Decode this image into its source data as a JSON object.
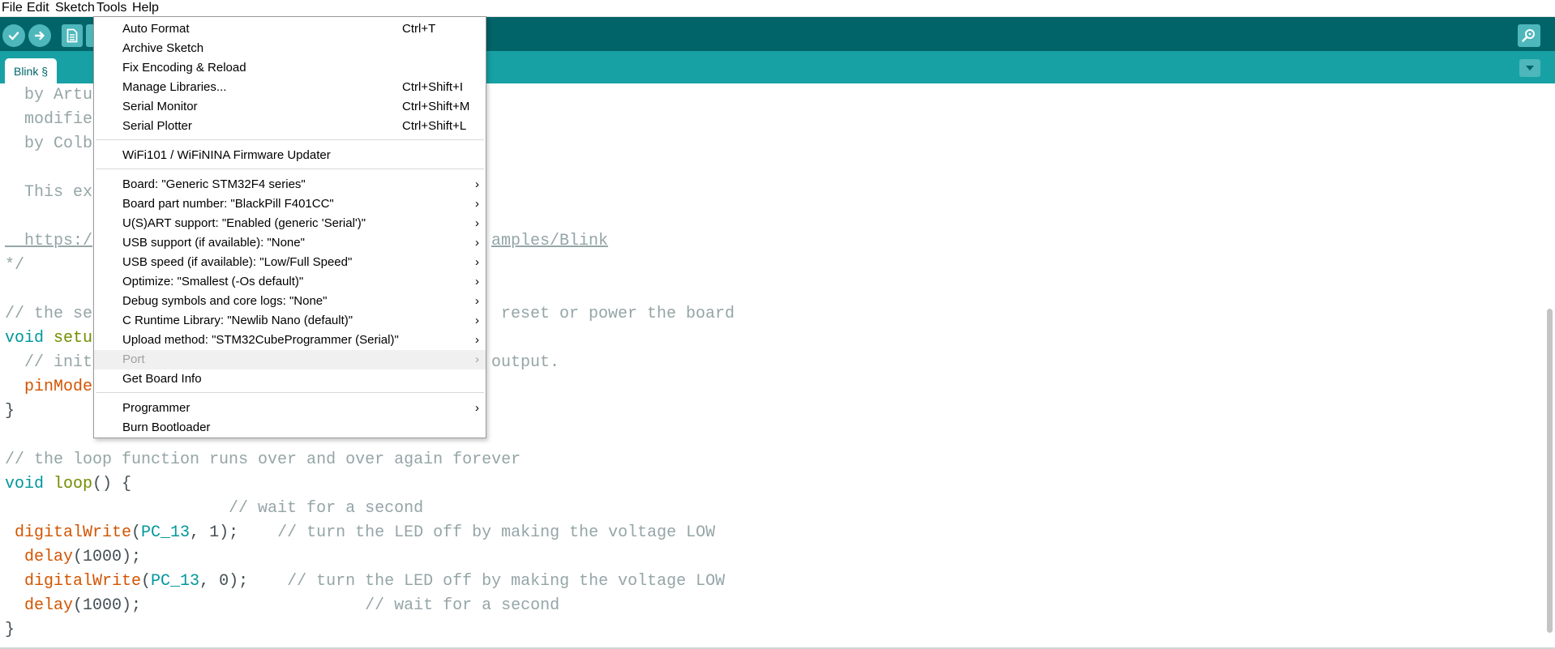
{
  "menubar": {
    "items": [
      "File",
      "Edit",
      "Sketch",
      "Tools",
      "Help"
    ]
  },
  "toolbar": {
    "verify_icon": "check-icon",
    "upload_icon": "arrow-right-icon",
    "new_icon": "document-icon",
    "serial_icon": "magnifier-icon"
  },
  "tabs": {
    "active_label": "Blink §",
    "menu_icon": "triangle-down-icon"
  },
  "tools_menu": {
    "items": [
      {
        "label": "Auto Format",
        "shortcut": "Ctrl+T"
      },
      {
        "label": "Archive Sketch",
        "shortcut": ""
      },
      {
        "label": "Fix Encoding & Reload",
        "shortcut": ""
      },
      {
        "label": "Manage Libraries...",
        "shortcut": "Ctrl+Shift+I"
      },
      {
        "label": "Serial Monitor",
        "shortcut": "Ctrl+Shift+M"
      },
      {
        "label": "Serial Plotter",
        "shortcut": "Ctrl+Shift+L"
      },
      {
        "label": "WiFi101 / WiFiNINA Firmware Updater",
        "shortcut": ""
      },
      {
        "label": "Board: \"Generic STM32F4 series\"",
        "shortcut": ""
      },
      {
        "label": "Board part number: \"BlackPill F401CC\"",
        "shortcut": ""
      },
      {
        "label": "U(S)ART support: \"Enabled (generic 'Serial')\"",
        "shortcut": ""
      },
      {
        "label": "USB support (if available): \"None\"",
        "shortcut": ""
      },
      {
        "label": "USB speed (if available): \"Low/Full Speed\"",
        "shortcut": ""
      },
      {
        "label": "Optimize: \"Smallest (-Os default)\"",
        "shortcut": ""
      },
      {
        "label": "Debug symbols and core logs: \"None\"",
        "shortcut": ""
      },
      {
        "label": "C Runtime Library: \"Newlib Nano (default)\"",
        "shortcut": ""
      },
      {
        "label": "Upload method: \"STM32CubeProgrammer (Serial)\"",
        "shortcut": ""
      },
      {
        "label": "Port",
        "shortcut": ""
      },
      {
        "label": "Get Board Info",
        "shortcut": ""
      },
      {
        "label": "Programmer",
        "shortcut": ""
      },
      {
        "label": "Burn Bootloader",
        "shortcut": ""
      }
    ],
    "submenu_arrow": "›"
  },
  "editor": {
    "lines": {
      "l1": "  by Artu",
      "l2": "  modifie",
      "l3": "  by Colb",
      "l4": "  This ex",
      "l5a": "  https:/",
      "l5b": "amples/Blink",
      "l6": "*/",
      "l7a": "// the se",
      "l7b": " reset or power the board",
      "l8a": "void",
      "l8b": " setu",
      "l9a": "  // init",
      "l9b": "output.",
      "l10": "  pinMode",
      "l11": "}",
      "l12": "// the loop function runs over and over again forever",
      "l13a": "void",
      "l13b": " loop",
      "l13c": "() {",
      "l14": "                       // wait for a second",
      "l15a": " digitalWrite",
      "l15b": "(",
      "l15c": "PC_13",
      "l15d": ", 1);    ",
      "l15e": "// turn the LED off by making the voltage LOW",
      "l16a": "  delay",
      "l16b": "(1000);",
      "l17a": "  digitalWrite",
      "l17b": "(",
      "l17c": "PC_13",
      "l17d": ", 0);    ",
      "l17e": "// turn the LED off by making the voltage LOW",
      "l18a": "  delay",
      "l18b": "(1000);                       ",
      "l18c": "// wait for a second",
      "l19": "}"
    }
  }
}
